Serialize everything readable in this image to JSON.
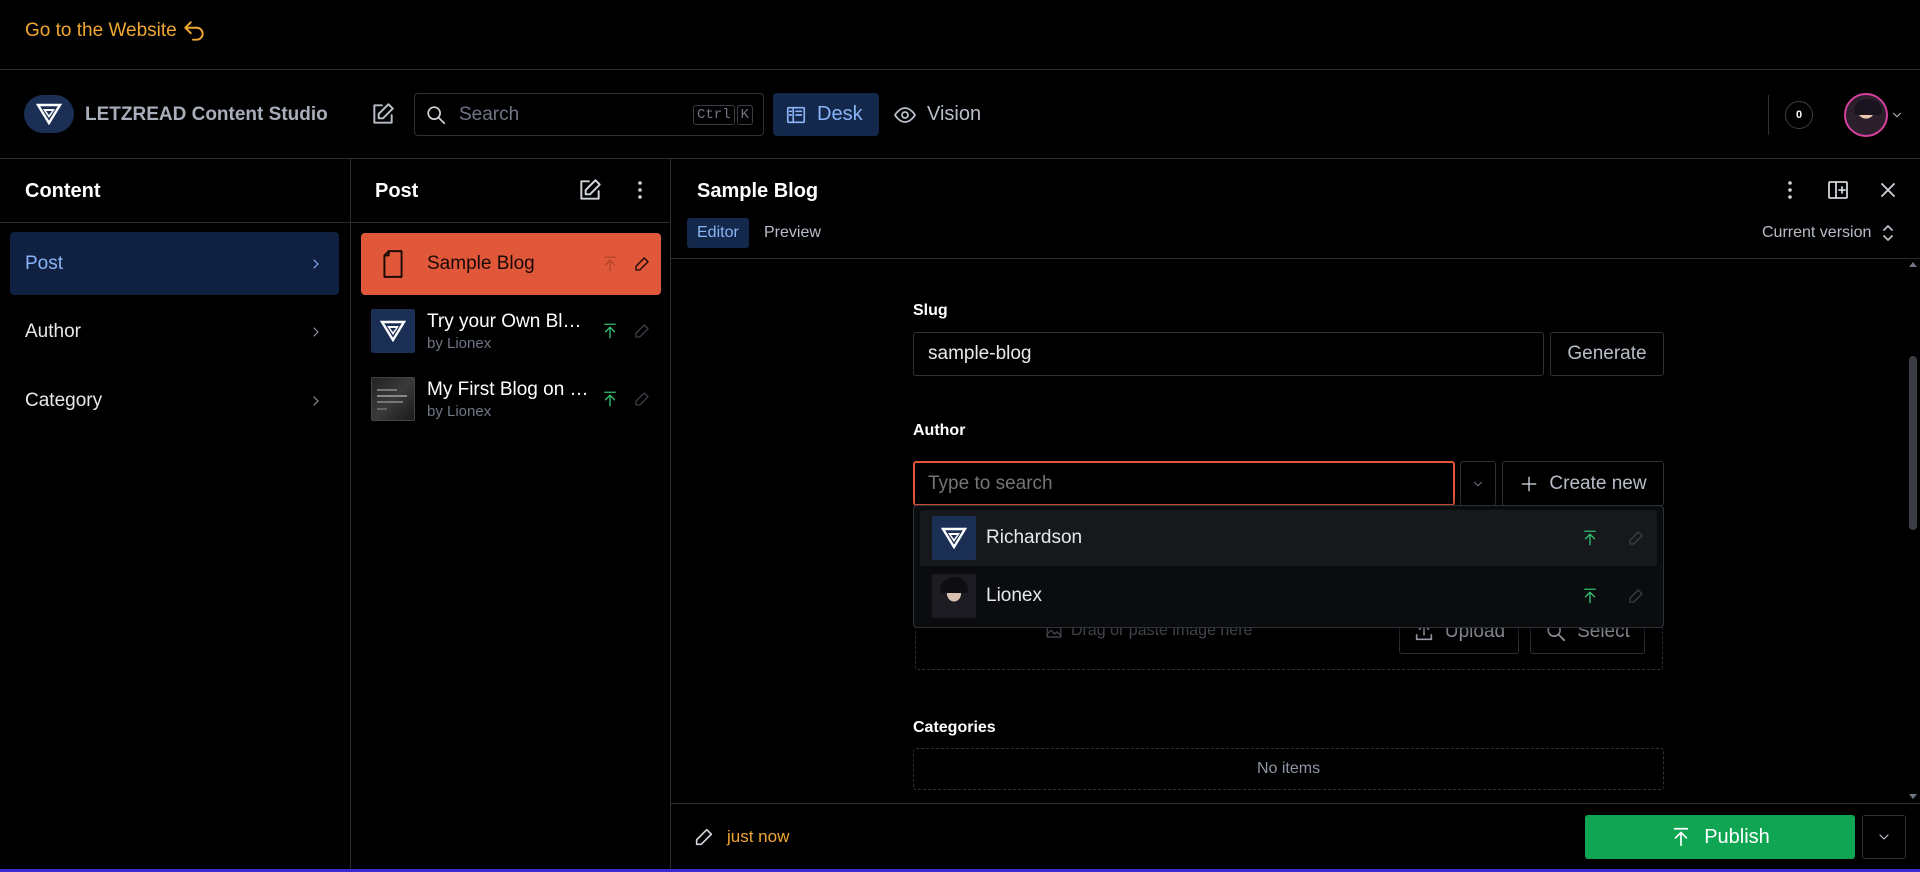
{
  "banner": {
    "link_text": "Go to the Website"
  },
  "navbar": {
    "brand": "LETZREAD Content Studio",
    "search_placeholder": "Search",
    "shortcut_keys": [
      "Ctrl",
      "K"
    ],
    "tools": [
      {
        "label": "Desk",
        "icon": "desk-icon",
        "active": true
      },
      {
        "label": "Vision",
        "icon": "eye-icon",
        "active": false
      }
    ],
    "notification_count": "0"
  },
  "content_pane": {
    "title": "Content",
    "items": [
      {
        "label": "Post",
        "active": true
      },
      {
        "label": "Author",
        "active": false
      },
      {
        "label": "Category",
        "active": false
      }
    ]
  },
  "post_pane": {
    "title": "Post",
    "documents": [
      {
        "title": "Sample Blog",
        "subtitle": "",
        "active": true
      },
      {
        "title": "Try your Own Blog Post",
        "subtitle": "by Lionex",
        "active": false
      },
      {
        "title": "My First Blog on Letzread",
        "subtitle": "by Lionex",
        "active": false
      }
    ]
  },
  "editor": {
    "title": "Sample Blog",
    "tabs": [
      {
        "label": "Editor",
        "active": true
      },
      {
        "label": "Preview",
        "active": false
      }
    ],
    "version_label": "Current version",
    "slug": {
      "label": "Slug",
      "value": "sample-blog",
      "generate_label": "Generate"
    },
    "author": {
      "label": "Author",
      "search_placeholder": "Type to search",
      "create_label": "Create new",
      "options": [
        {
          "name": "Richardson",
          "avatar": "logo-avatar"
        },
        {
          "name": "Lionex",
          "avatar": "character-avatar"
        }
      ]
    },
    "image": {
      "drop_text": "Drag or paste image here",
      "upload_label": "Upload",
      "select_label": "Select"
    },
    "categories": {
      "label": "Categories",
      "empty_text": "No items"
    }
  },
  "footer": {
    "status": "just now",
    "publish_label": "Publish"
  },
  "colors": {
    "accent_orange": "#f0a732",
    "selected_doc": "#e0573a",
    "publish_green": "#0fa552",
    "focus_red": "#e0573a",
    "link_blue": "#8ab4f8"
  }
}
